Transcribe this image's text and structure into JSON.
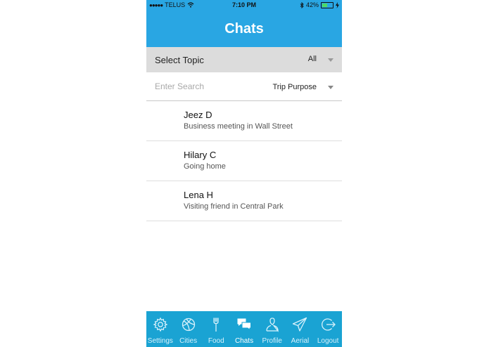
{
  "status_bar": {
    "carrier": "TELUS",
    "time": "7:10 PM",
    "battery": "42%",
    "battery_level": 0.42
  },
  "header": {
    "title": "Chats"
  },
  "topic": {
    "label": "Select Topic",
    "value": "All"
  },
  "search": {
    "placeholder": "Enter Search",
    "value": "",
    "purpose": "Trip Purpose"
  },
  "chats": [
    {
      "name": "Jeez D",
      "message": "Business meeting in Wall Street"
    },
    {
      "name": "Hilary C",
      "message": "Going home"
    },
    {
      "name": "Lena H",
      "message": "Visiting friend in Central Park"
    }
  ],
  "tabs": [
    {
      "label": "Settings",
      "icon": "gear-icon"
    },
    {
      "label": "Cities",
      "icon": "basketball-icon"
    },
    {
      "label": "Food",
      "icon": "fork-icon"
    },
    {
      "label": "Chats",
      "icon": "chat-bubbles-icon",
      "active": true
    },
    {
      "label": "Profile",
      "icon": "person-icon"
    },
    {
      "label": "Aerial",
      "icon": "paper-plane-icon"
    },
    {
      "label": "Logout",
      "icon": "logout-icon"
    }
  ],
  "colors": {
    "header": "#29a6e3",
    "tabbar": "#1aa3d3",
    "topic_bar": "#dcdcdc"
  }
}
